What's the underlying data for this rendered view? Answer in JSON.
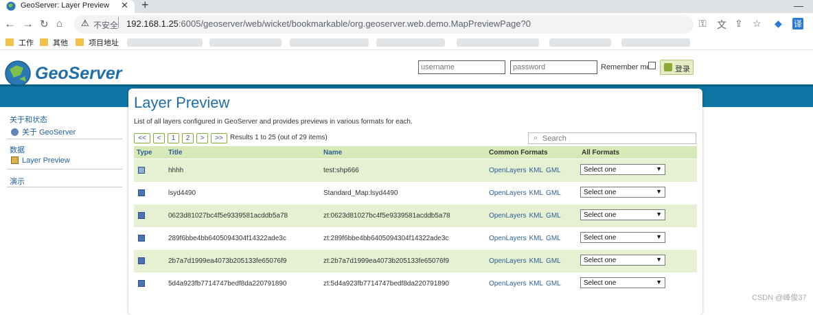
{
  "browser": {
    "tab_title": "GeoServer: Layer Preview",
    "tab_close": "✕",
    "new_tab": "+",
    "minimize": "—",
    "insecure_label": "不安全",
    "url_host": "192.168.1.25",
    "url_rest": ":6005/geoserver/web/wicket/bookmarkable/org.geoserver.web.demo.MapPreviewPage?0",
    "bookmarks": [
      "工作",
      "其他",
      "项目地址"
    ]
  },
  "header": {
    "logo_text": "GeoServer",
    "username_placeholder": "username",
    "password_placeholder": "password",
    "remember_label": "Remember me",
    "login_label": "登录"
  },
  "sidebar": {
    "section_about": "关于和状态",
    "item_about": "关于 GeoServer",
    "section_data": "数据",
    "item_layer_preview": "Layer Preview",
    "section_demos": "演示"
  },
  "main": {
    "title": "Layer Preview",
    "description": "List of all layers configured in GeoServer and provides previews in various formats for each.",
    "pager": {
      "first": "<<",
      "prev": "<",
      "page1": "1",
      "page2": "2",
      "next": ">",
      "last": ">>",
      "info": "Results 1 to 25 (out of 29 items)"
    },
    "search_placeholder": "Search",
    "columns": {
      "type": "Type",
      "title": "Title",
      "name": "Name",
      "common": "Common Formats",
      "all": "All Formats"
    },
    "common_formats": [
      "OpenLayers",
      "KML",
      "GML"
    ],
    "select_value": "Select one",
    "rows": [
      {
        "type": "raster",
        "title": "hhhh",
        "name": "test:shp666"
      },
      {
        "type": "vector",
        "title": "lsyd4490",
        "name": "Standard_Map:lsyd4490"
      },
      {
        "type": "vector",
        "title": "0623d81027bc4f5e9339581acddb5a78",
        "name": "zt:0623d81027bc4f5e9339581acddb5a78"
      },
      {
        "type": "vector",
        "title": "289f6bbe4bb6405094304f14322ade3c",
        "name": "zt:289f6bbe4bb6405094304f14322ade3c"
      },
      {
        "type": "vector",
        "title": "2b7a7d1999ea4073b205133fe65076f9",
        "name": "zt:2b7a7d1999ea4073b205133fe65076f9"
      },
      {
        "type": "vector",
        "title": "5d4a923fb7714747bedf8da220791890",
        "name": "zt:5d4a923fb7714747bedf8da220791890"
      }
    ]
  },
  "watermark": "CSDN @峰俊37",
  "colors": {
    "brand_blue": "#0d76a5",
    "row_alt": "#e6f0d3",
    "link": "#2b5f96"
  }
}
